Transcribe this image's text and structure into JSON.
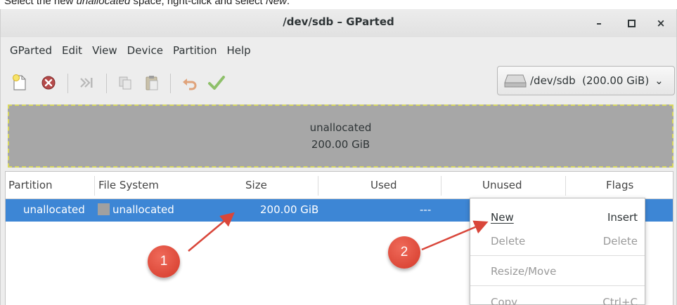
{
  "caption": {
    "pre": "Select the new ",
    "em1": "unallocated",
    "mid": " space, right-click and select ",
    "em2": "New",
    "post": "."
  },
  "window": {
    "title": "/dev/sdb – GParted",
    "minimize_glyph": "–",
    "maximize_glyph": "▫",
    "close_glyph": "×"
  },
  "menubar": [
    "GParted",
    "Edit",
    "View",
    "Device",
    "Partition",
    "Help"
  ],
  "toolbar": {
    "icons": [
      "new-icon",
      "delete-icon",
      "resize-icon",
      "copy-icon",
      "paste-icon",
      "undo-icon",
      "apply-icon"
    ]
  },
  "device_selector": {
    "value": "/dev/sdb  (200.00 GiB)",
    "chevron": "⌄"
  },
  "disk_map": {
    "label": "unallocated",
    "size": "200.00 GiB"
  },
  "table": {
    "columns": [
      "Partition",
      "File System",
      "Size",
      "Used",
      "Unused",
      "Flags"
    ],
    "rows": [
      {
        "partition": "unallocated",
        "filesystem": "unallocated",
        "size": "200.00 GiB",
        "used": "---",
        "unused": "",
        "flags": ""
      }
    ]
  },
  "context_menu": {
    "items": [
      {
        "label": "New",
        "accel": "Insert",
        "enabled": true
      },
      {
        "label": "Delete",
        "accel": "Delete",
        "enabled": false
      },
      {
        "label": "Resize/Move",
        "accel": "",
        "enabled": false
      },
      {
        "label": "Copy",
        "accel": "Ctrl+C",
        "enabled": false
      }
    ]
  },
  "callouts": [
    "1",
    "2"
  ],
  "colors": {
    "selection": "#3d86d5",
    "callout": "#d9463a",
    "disk_map": "#a7a7a7"
  }
}
